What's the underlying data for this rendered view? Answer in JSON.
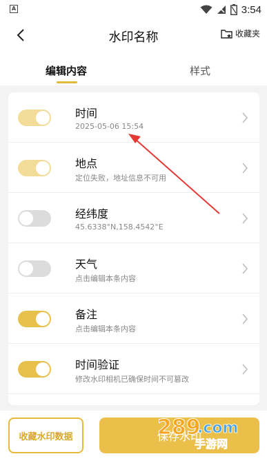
{
  "status": {
    "time": "3:54",
    "left_icon": "A"
  },
  "header": {
    "title": "水印名称",
    "favorites_label": "收藏夹"
  },
  "tabs": [
    {
      "label": "编辑内容"
    },
    {
      "label": "样式"
    }
  ],
  "rows": [
    {
      "title": "时间",
      "subtitle": "2025-05-06 15:54",
      "toggle": "on-light"
    },
    {
      "title": "地点",
      "subtitle": "定位失败，地址信息不可用",
      "toggle": "on-light"
    },
    {
      "title": "经纬度",
      "subtitle": "45.6338°N,158.4542°E",
      "toggle": "off"
    },
    {
      "title": "天气",
      "subtitle": "点击编辑本条内容",
      "toggle": "off"
    },
    {
      "title": "备注",
      "subtitle": "点击编辑本条内容",
      "toggle": "on"
    },
    {
      "title": "时间验证",
      "subtitle": "修改水印相机已确保时间不可篡改",
      "toggle": "on"
    }
  ],
  "bottom": {
    "save_data_label": "收藏水印数据",
    "primary_label": "保存水印"
  },
  "watermark": {
    "brand": "289",
    "domain_text": ".com",
    "site_text": "手游网"
  },
  "colors": {
    "accent": "#e6b93a",
    "toggle_on": "#e8c14c",
    "toggle_on_light": "#f3dc98",
    "toggle_off": "#dcdcdc",
    "arrow": "#e53935"
  }
}
